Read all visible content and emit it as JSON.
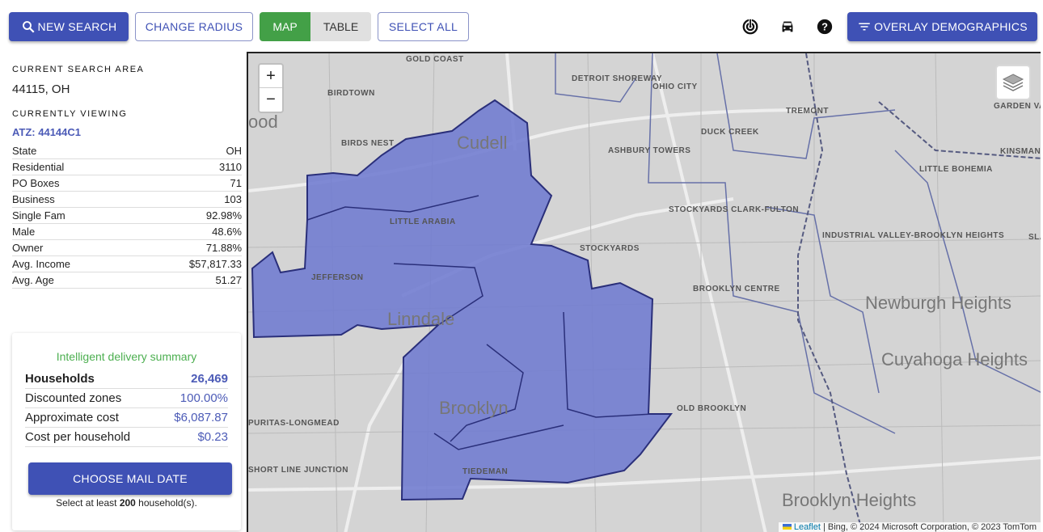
{
  "toolbar": {
    "new_search": "NEW SEARCH",
    "change_radius": "CHANGE RADIUS",
    "map": "MAP",
    "table": "TABLE",
    "select_all": "SELECT ALL",
    "overlay": "OVERLAY DEMOGRAPHICS",
    "icons": [
      "radar-icon",
      "car-icon",
      "help-icon",
      "filter-icon",
      "search-icon"
    ]
  },
  "sidebar": {
    "search_area_label": "CURRENT SEARCH AREA",
    "search_area": "44115, OH",
    "viewing_label": "CURRENTLY VIEWING",
    "atz": "ATZ: 44144C1",
    "stats": [
      {
        "label": "State",
        "value": "OH"
      },
      {
        "label": "Residential",
        "value": "3110"
      },
      {
        "label": "PO Boxes",
        "value": "71"
      },
      {
        "label": "Business",
        "value": "103"
      },
      {
        "label": "Single Fam",
        "value": "92.98%"
      },
      {
        "label": "Male",
        "value": "48.6%"
      },
      {
        "label": "Owner",
        "value": "71.88%"
      },
      {
        "label": "Avg. Income",
        "value": "$57,817.33"
      },
      {
        "label": "Avg. Age",
        "value": "51.27"
      }
    ]
  },
  "summary": {
    "title": "Intelligent delivery summary",
    "rows": [
      {
        "label": "Households",
        "value": "26,469"
      },
      {
        "label": "Discounted zones",
        "value": "100.00%"
      },
      {
        "label": "Approximate cost",
        "value": "$6,087.87"
      },
      {
        "label": "Cost per household",
        "value": "$0.23"
      }
    ],
    "button": "CHOOSE MAIL DATE",
    "note_pre": "Select at least ",
    "note_num": "200",
    "note_post": " household(s)."
  },
  "map": {
    "zoom_in": "+",
    "zoom_out": "−",
    "attribution_link": "Leaflet",
    "attribution": " | Bing, © 2024 Microsoft Corporation, © 2023 TomTom",
    "labels": [
      "GOLD COAST",
      "DETROIT SHOREWAY",
      "OHIO CITY",
      "TREMONT",
      "BIRDTOWN",
      "BIRDS NEST",
      "DUCK CREEK",
      "ASHBURY TOWERS",
      "LITTLE BOHEMIA",
      "STOCKYARDS CLARK-FULTON",
      "LITTLE ARABIA",
      "STOCKYARDS",
      "INDUSTRIAL VALLEY-BROOKLYN HEIGHTS",
      "SLAVIC VILLAGE",
      "JEFFERSON",
      "BROOKLYN CENTRE",
      "OLD BROOKLYN",
      "PURITAS-LONGMEAD",
      "SHORT LINE JUNCTION",
      "TIEDEMAN",
      "GARDEN VALLEY",
      "KINSMAN"
    ],
    "big_labels": [
      "Cudell",
      "Linndale",
      "Brooklyn",
      "Newburgh Heights",
      "Cuyahoga Heights",
      "Brooklyn Heights",
      "ood"
    ],
    "selection_color": "#6f7bd0"
  }
}
